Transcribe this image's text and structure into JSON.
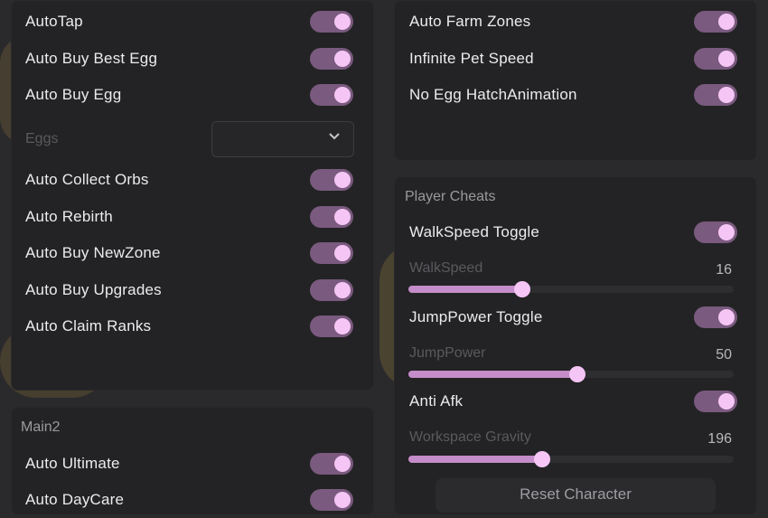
{
  "left_panel": {
    "items": [
      {
        "label": "AutoTap",
        "on": true
      },
      {
        "label": "Auto Buy Best Egg",
        "on": true
      },
      {
        "label": "Auto Buy Egg",
        "on": true
      }
    ],
    "eggs_label": "Eggs",
    "eggs_dropdown_value": "",
    "items2": [
      {
        "label": "Auto Collect Orbs",
        "on": true
      },
      {
        "label": "Auto Rebirth",
        "on": true
      },
      {
        "label": "Auto Buy NewZone",
        "on": true
      },
      {
        "label": "Auto Buy Upgrades",
        "on": true
      },
      {
        "label": "Auto Claim Ranks",
        "on": true
      }
    ]
  },
  "main2_panel": {
    "title": "Main2",
    "items": [
      {
        "label": "Auto Ultimate",
        "on": true
      },
      {
        "label": "Auto DayCare",
        "on": true
      }
    ]
  },
  "right_top_panel": {
    "items": [
      {
        "label": "Auto Farm Zones",
        "on": true
      },
      {
        "label": "Infinite Pet Speed",
        "on": true
      },
      {
        "label": "No Egg HatchAnimation",
        "on": true
      }
    ]
  },
  "player_cheats": {
    "title": "Player Cheats",
    "walkspeed_toggle": "WalkSpeed Toggle",
    "walkspeed_label": "WalkSpeed",
    "walkspeed_value": "16",
    "walkspeed_fraction": 0.35,
    "jumppower_toggle": "JumpPower Toggle",
    "jumppower_label": "JumpPower",
    "jumppower_value": "50",
    "jumppower_fraction": 0.52,
    "anti_afk": "Anti Afk",
    "gravity_label": "Workspace Gravity",
    "gravity_value": "196",
    "gravity_fraction": 0.41,
    "reset_button": "Reset Character"
  },
  "colors": {
    "toggle_track": "#7a5a7e",
    "toggle_knob": "#f5c6f5",
    "slider_fill": "#c48cc8"
  }
}
